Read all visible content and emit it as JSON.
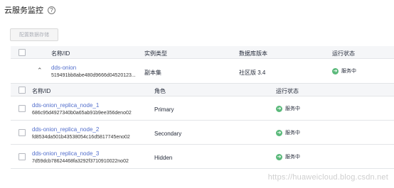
{
  "page": {
    "title": "云服务监控"
  },
  "toolbar": {
    "config_label": "配置数据存储"
  },
  "outer_table": {
    "headers": {
      "name_id": "名称/ID",
      "instance_type": "实例类型",
      "db_version": "数据库版本",
      "run_status": "运行状态"
    },
    "row": {
      "name": "dds-onion",
      "id": "519491bb8abe480d9666d04520123...",
      "instance_type": "副本集",
      "db_version": "社区版 3.4",
      "status": "服务中"
    }
  },
  "inner_table": {
    "headers": {
      "name_id": "名称/ID",
      "role": "角色",
      "run_status": "运行状态"
    },
    "rows": [
      {
        "name": "dds-onion_replica_node_1",
        "id": "686c95d4927340b0a65ab91b9ee356deno02",
        "role": "Primary",
        "status": "服务中"
      },
      {
        "name": "dds-onion_replica_node_2",
        "id": "fd8534da501b43538054c16d5817745eno02",
        "role": "Secondary",
        "status": "服务中"
      },
      {
        "name": "dds-onion_replica_node_3",
        "id": "7d59dcb78624468fa3292f3710910022no02",
        "role": "Hidden",
        "status": "服务中"
      }
    ]
  },
  "watermark": "https://huaweicloud.blog.csdn.net",
  "colors": {
    "link": "#526ecc",
    "status_ok": "#5ab97a",
    "header_bg": "#f5f6f8"
  }
}
